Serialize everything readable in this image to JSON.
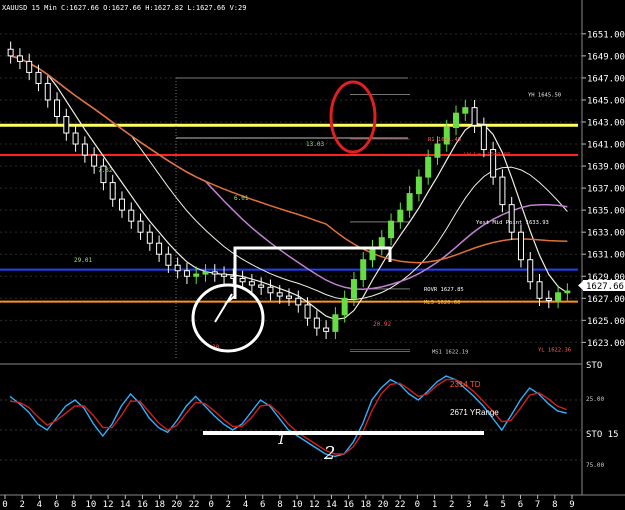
{
  "header": {
    "text": "XAUUSD 15 Min  C:1627.66  O:1627.66  H:1627.82  L:1627.66  V:29"
  },
  "chart_data": {
    "type": "candlestick",
    "symbol": "XAUUSD",
    "timeframe": "15 Min",
    "price_axis": {
      "ticks": [
        "1651.00",
        "1649.00",
        "1647.00",
        "1645.00",
        "1643.00",
        "1641.00",
        "1639.00",
        "1637.00",
        "1635.00",
        "1633.00",
        "1631.00",
        "1629.00",
        "1627.00",
        "1625.00",
        "1623.00"
      ],
      "current_price_label": "1627.66",
      "range": [
        1621.4,
        1652.8
      ]
    },
    "time_axis_ticks": [
      "0",
      "2",
      "4",
      "6",
      "8",
      "10",
      "12",
      "14",
      "16",
      "18",
      "20",
      "22",
      "0",
      "2",
      "4",
      "6",
      "8",
      "10",
      "12",
      "14",
      "16",
      "18",
      "20",
      "22",
      "0",
      "1",
      "2",
      "3",
      "4",
      "5",
      "6",
      "7",
      "8",
      "9"
    ],
    "close_series": [
      1649,
      1648.5,
      1647.5,
      1646.5,
      1645,
      1643.5,
      1642,
      1641,
      1640,
      1639,
      1637.5,
      1636,
      1635,
      1634,
      1633,
      1632,
      1631,
      1630,
      1629.5,
      1629,
      1629.2,
      1629.4,
      1629.2,
      1629,
      1628.8,
      1628.5,
      1628.2,
      1628,
      1627.5,
      1627.2,
      1627,
      1626.4,
      1625.2,
      1624.3,
      1624,
      1625.5,
      1627,
      1628.7,
      1630.5,
      1631.6,
      1632.5,
      1634,
      1635,
      1636.5,
      1638,
      1639.8,
      1641,
      1642.5,
      1643.8,
      1644.3,
      1642.7,
      1640.5,
      1638,
      1635.5,
      1633,
      1630.5,
      1628.5,
      1627,
      1626.8,
      1627.5,
      1627.66
    ],
    "price_lines": [
      {
        "label": "YH 1645.50",
        "price": 1645.5,
        "color": "#e8e8e8"
      },
      {
        "label": "R1 1641.45",
        "price": 1641.45,
        "color": "#ff6060"
      },
      {
        "label": "LW Low 1640.08",
        "price": 1640.08,
        "color": "#ff3030"
      },
      {
        "label": "Yest Mid Point 1633.93",
        "price": 1633.93,
        "color": "#ffffff"
      },
      {
        "label": "ROVR 1627.85",
        "price": 1627.85,
        "color": "#ffffff"
      },
      {
        "label": "ML3 1626.66",
        "price": 1626.66,
        "color": "#ffc040"
      },
      {
        "label": "YL 1622.36",
        "price": 1622.36,
        "color": "#ff6060"
      },
      {
        "label": "MS1 1622.19",
        "price": 1622.19,
        "color": "#d0d0d0"
      }
    ],
    "move_labels": [
      "7.32",
      "29.01",
      "6.01",
      "13.03",
      "20.92",
      "20"
    ],
    "stochastic": {
      "title": "STO",
      "levels": [
        "25.00",
        "STO 15",
        "75.00"
      ],
      "annotations": [
        "2314 TD",
        "2671 YRange",
        "1",
        "2"
      ],
      "k_values": [
        78,
        72,
        65,
        55,
        50,
        60,
        70,
        75,
        68,
        55,
        45,
        55,
        70,
        80,
        72,
        60,
        52,
        48,
        58,
        70,
        78,
        70,
        62,
        55,
        50,
        55,
        65,
        75,
        70,
        60,
        50,
        45,
        40,
        35,
        30,
        28,
        30,
        40,
        55,
        75,
        85,
        92,
        88,
        80,
        75,
        82,
        90,
        95,
        92,
        85,
        78,
        70,
        60,
        50,
        62,
        75,
        85,
        80,
        72,
        66,
        64
      ],
      "d_values": [
        74,
        73,
        69,
        61,
        54,
        58,
        64,
        70,
        70,
        62,
        52,
        52,
        62,
        74,
        74,
        65,
        56,
        50,
        54,
        64,
        73,
        72,
        66,
        59,
        53,
        53,
        60,
        70,
        71,
        64,
        55,
        48,
        43,
        38,
        33,
        30,
        30,
        36,
        48,
        66,
        80,
        88,
        89,
        84,
        78,
        80,
        87,
        92,
        92,
        88,
        82,
        74,
        66,
        57,
        58,
        68,
        79,
        81,
        76,
        70,
        67
      ]
    }
  },
  "annotations": {
    "red_ellipse_label": "top",
    "white_circle_label": "bottom"
  },
  "colors": {
    "background": "#000000",
    "grid": "#2a2a2a",
    "bull_candle": "#66dd44",
    "bear_candle": "#ffffff",
    "ma_orange": "#e0703a",
    "ma_purple": "#c080d0",
    "ma_white": "#f0f0e0",
    "yellow_line": "#ffff60",
    "red_line": "#ff2020",
    "blue_line": "#2040ff",
    "orange_line": "#ff9020",
    "sto_k": "#30b0ff",
    "sto_d": "#d02020"
  }
}
